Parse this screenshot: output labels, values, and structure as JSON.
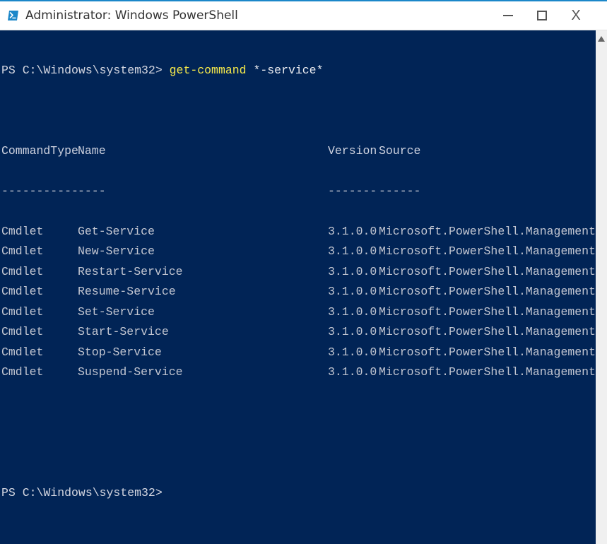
{
  "window": {
    "title": "Administrator: Windows PowerShell"
  },
  "terminal": {
    "prompt": "PS C:\\Windows\\system32> ",
    "command_name": "get-command",
    "command_args": " *-service*",
    "headers": {
      "type": "CommandType",
      "name": "Name",
      "version": "Version",
      "source": "Source"
    },
    "dividers": {
      "type": "-----------",
      "name": "----",
      "version": "-------",
      "source": "------"
    },
    "rows": [
      {
        "type": "Cmdlet",
        "name": "Get-Service",
        "version": "3.1.0.0",
        "source": "Microsoft.PowerShell.Management"
      },
      {
        "type": "Cmdlet",
        "name": "New-Service",
        "version": "3.1.0.0",
        "source": "Microsoft.PowerShell.Management"
      },
      {
        "type": "Cmdlet",
        "name": "Restart-Service",
        "version": "3.1.0.0",
        "source": "Microsoft.PowerShell.Management"
      },
      {
        "type": "Cmdlet",
        "name": "Resume-Service",
        "version": "3.1.0.0",
        "source": "Microsoft.PowerShell.Management"
      },
      {
        "type": "Cmdlet",
        "name": "Set-Service",
        "version": "3.1.0.0",
        "source": "Microsoft.PowerShell.Management"
      },
      {
        "type": "Cmdlet",
        "name": "Start-Service",
        "version": "3.1.0.0",
        "source": "Microsoft.PowerShell.Management"
      },
      {
        "type": "Cmdlet",
        "name": "Stop-Service",
        "version": "3.1.0.0",
        "source": "Microsoft.PowerShell.Management"
      },
      {
        "type": "Cmdlet",
        "name": "Suspend-Service",
        "version": "3.1.0.0",
        "source": "Microsoft.PowerShell.Management"
      }
    ],
    "prompt2": "PS C:\\Windows\\system32> "
  }
}
